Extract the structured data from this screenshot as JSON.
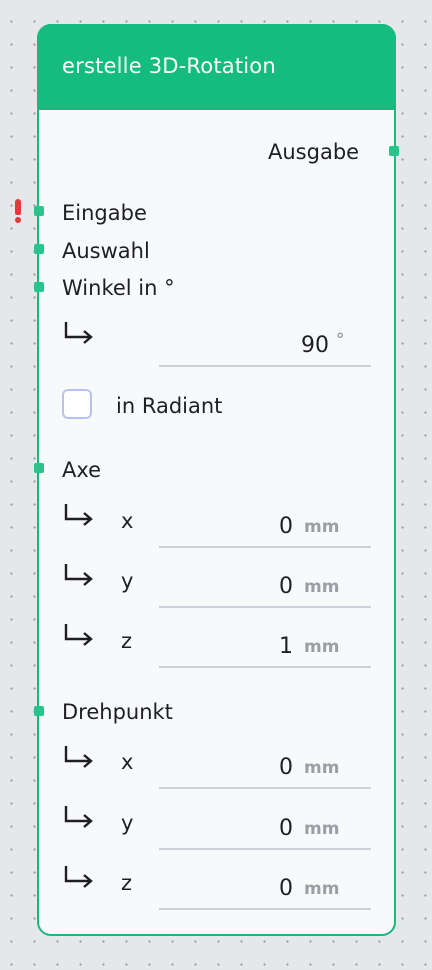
{
  "node": {
    "title": "erstelle 3D-Rotation",
    "output_label": "Ausgabe",
    "inputs": {
      "eingabe": "Eingabe",
      "auswahl": "Auswahl",
      "winkel": "Winkel in °"
    },
    "angle": {
      "value": "90",
      "unit": "°"
    },
    "radiant": {
      "label": "in Radiant",
      "checked": false
    },
    "axe": {
      "label": "Axe",
      "x": {
        "label": "x",
        "value": "0",
        "unit": "mm"
      },
      "y": {
        "label": "y",
        "value": "0",
        "unit": "mm"
      },
      "z": {
        "label": "z",
        "value": "1",
        "unit": "mm"
      }
    },
    "drehpunkt": {
      "label": "Drehpunkt",
      "x": {
        "label": "x",
        "value": "0",
        "unit": "mm"
      },
      "y": {
        "label": "y",
        "value": "0",
        "unit": "mm"
      },
      "z": {
        "label": "z",
        "value": "0",
        "unit": "mm"
      }
    }
  },
  "icons": {
    "warning": "exclamation-warning-icon",
    "sub_arrow": "turn-down-right-arrow-icon"
  },
  "colors": {
    "header": "#15bc80",
    "port": "#27c48b",
    "warning": "#e0393e",
    "unit_text": "#9b9ea5"
  }
}
